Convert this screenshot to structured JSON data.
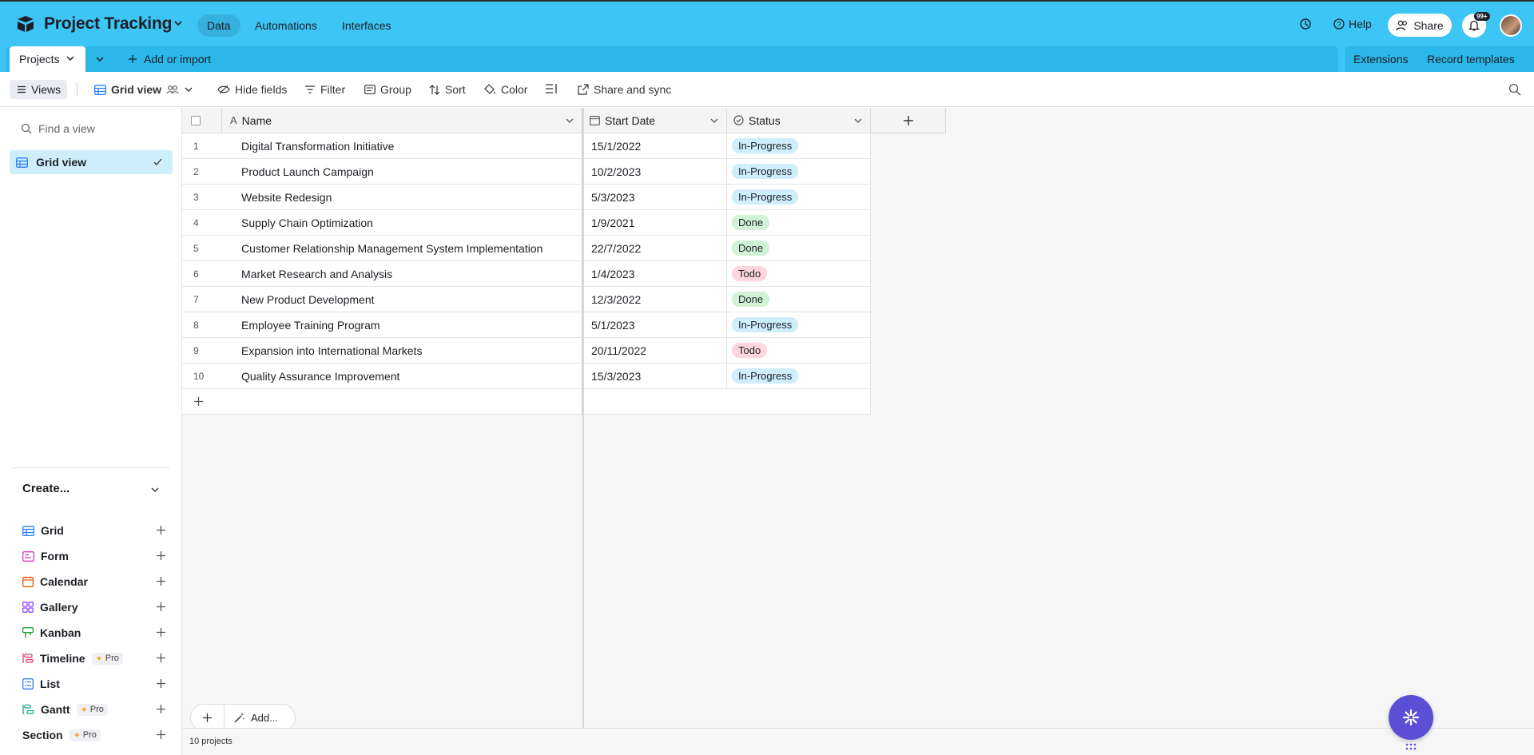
{
  "app": {
    "base_title": "Project Tracking"
  },
  "top_tabs": {
    "data": "Data",
    "automations": "Automations",
    "interfaces": "Interfaces"
  },
  "top_right": {
    "help": "Help",
    "share": "Share",
    "notification_count": "99+"
  },
  "table_tabs": {
    "active": "Projects",
    "add_import": "Add or import",
    "extensions": "Extensions",
    "record_templates": "Record templates"
  },
  "toolbar": {
    "views": "Views",
    "grid_view": "Grid view",
    "hide_fields": "Hide fields",
    "filter": "Filter",
    "group": "Group",
    "sort": "Sort",
    "color": "Color",
    "share_sync": "Share and sync"
  },
  "sidebar": {
    "find_placeholder": "Find a view",
    "active_view": "Grid view",
    "create_label": "Create...",
    "create_items": [
      {
        "label": "Grid",
        "icon": "grid-icon",
        "color": "#2d7ff9"
      },
      {
        "label": "Form",
        "icon": "form-icon",
        "color": "#d63ac2"
      },
      {
        "label": "Calendar",
        "icon": "calendar-icon",
        "color": "#e8590c"
      },
      {
        "label": "Gallery",
        "icon": "gallery-icon",
        "color": "#8b46ff"
      },
      {
        "label": "Kanban",
        "icon": "kanban-icon",
        "color": "#20a33a"
      },
      {
        "label": "Timeline",
        "icon": "timeline-icon",
        "color": "#e03a6a",
        "pro": "Pro"
      },
      {
        "label": "List",
        "icon": "list-icon",
        "color": "#2d7ff9"
      },
      {
        "label": "Gantt",
        "icon": "gantt-icon",
        "color": "#0fa37f",
        "pro": "Pro"
      },
      {
        "label": "Section",
        "icon": "",
        "color": "#1d1f25",
        "pro": "Pro"
      }
    ]
  },
  "grid": {
    "columns": {
      "name": "Name",
      "start_date": "Start Date",
      "status": "Status"
    },
    "rows": [
      {
        "num": "1",
        "name": "Digital Transformation Initiative",
        "date": "15/1/2022",
        "status": "In-Progress"
      },
      {
        "num": "2",
        "name": "Product Launch Campaign",
        "date": "10/2/2023",
        "status": "In-Progress"
      },
      {
        "num": "3",
        "name": "Website Redesign",
        "date": "5/3/2023",
        "status": "In-Progress"
      },
      {
        "num": "4",
        "name": "Supply Chain Optimization",
        "date": "1/9/2021",
        "status": "Done"
      },
      {
        "num": "5",
        "name": "Customer Relationship Management System Implementation",
        "date": "22/7/2022",
        "status": "Done"
      },
      {
        "num": "6",
        "name": "Market Research and Analysis",
        "date": "1/4/2023",
        "status": "Todo"
      },
      {
        "num": "7",
        "name": "New Product Development",
        "date": "12/3/2022",
        "status": "Done"
      },
      {
        "num": "8",
        "name": "Employee Training Program",
        "date": "5/1/2023",
        "status": "In-Progress"
      },
      {
        "num": "9",
        "name": "Expansion into International Markets",
        "date": "20/11/2022",
        "status": "Todo"
      },
      {
        "num": "10",
        "name": "Quality Assurance Improvement",
        "date": "15/3/2023",
        "status": "In-Progress"
      }
    ],
    "add_label": "Add...",
    "record_count": "10 projects"
  },
  "colors": {
    "topbar": "#3dc5f5",
    "in_progress": "#cfeefb",
    "done": "#d2f2d5",
    "todo": "#ffd6e0",
    "fab": "#5b4fd6"
  }
}
